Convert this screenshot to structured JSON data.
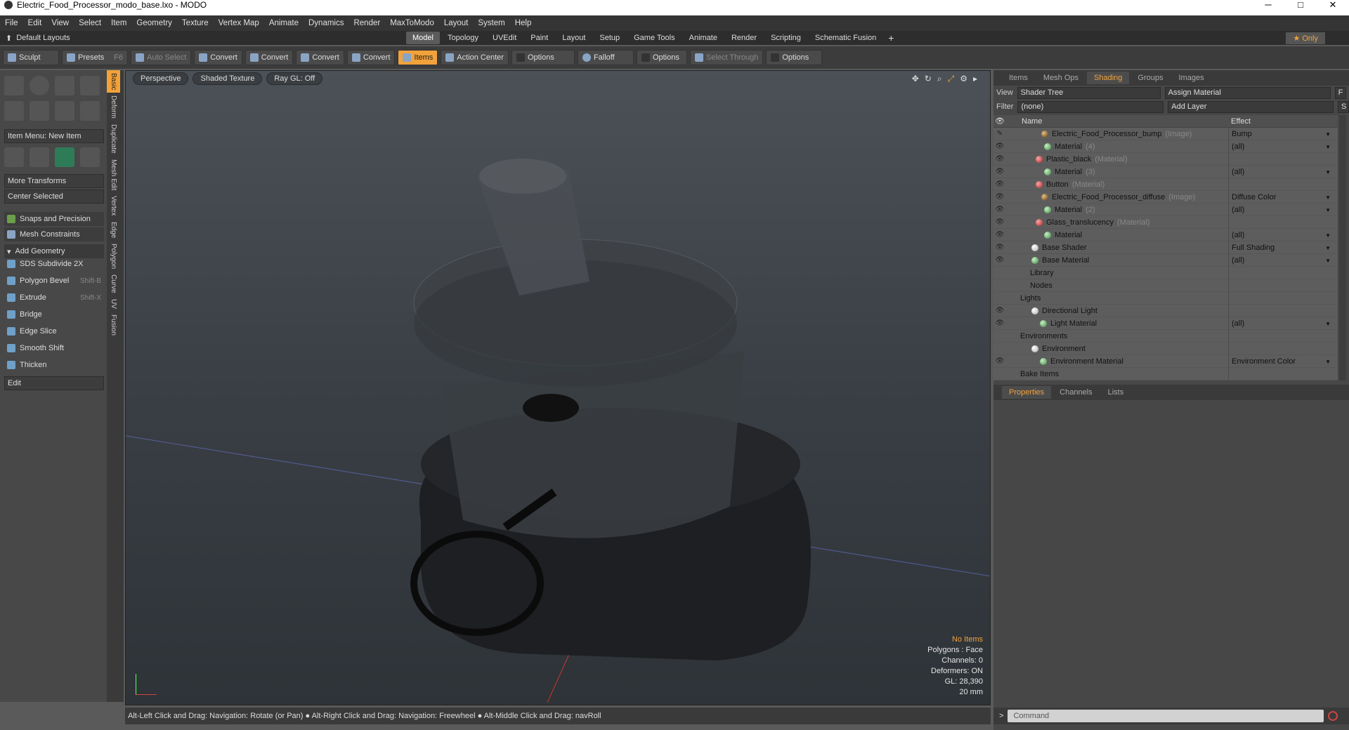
{
  "window": {
    "title": "Electric_Food_Processor_modo_base.lxo - MODO",
    "min": "─",
    "max": "□",
    "close": "✕"
  },
  "menu": [
    "File",
    "Edit",
    "View",
    "Select",
    "Item",
    "Geometry",
    "Texture",
    "Vertex Map",
    "Animate",
    "Dynamics",
    "Render",
    "MaxToModo",
    "Layout",
    "System",
    "Help"
  ],
  "layoutbar": {
    "default_layouts": "Default Layouts",
    "tabs": [
      "Model",
      "Topology",
      "UVEdit",
      "Paint",
      "Layout",
      "Setup",
      "Game Tools",
      "Animate",
      "Render",
      "Scripting",
      "Schematic Fusion"
    ],
    "active_tab": "Model",
    "plus": "+",
    "only": "★ Only"
  },
  "toolbar": {
    "sculpt": "Sculpt",
    "presets": "Presets",
    "presets_key": "F6",
    "auto_select": "Auto Select",
    "convert1": "Convert",
    "convert2": "Convert",
    "convert3": "Convert",
    "convert4": "Convert",
    "items": "Items",
    "action_center": "Action Center",
    "options1": "Options",
    "falloff": "Falloff",
    "options2": "Options",
    "select_through": "Select Through",
    "options3": "Options"
  },
  "left": {
    "item_menu": "Item Menu: New Item",
    "more_transforms": "More Transforms",
    "center_selected": "Center Selected",
    "snaps": "Snaps and Precision",
    "mesh_constraints": "Mesh Constraints",
    "add_geometry": "Add Geometry",
    "tools": [
      {
        "label": "SDS Subdivide 2X",
        "key": ""
      },
      {
        "label": "Polygon Bevel",
        "key": "Shift-B"
      },
      {
        "label": "Extrude",
        "key": "Shift-X"
      },
      {
        "label": "Bridge",
        "key": ""
      },
      {
        "label": "Edge Slice",
        "key": ""
      },
      {
        "label": "Smooth Shift",
        "key": ""
      },
      {
        "label": "Thicken",
        "key": ""
      }
    ],
    "edit": "Edit",
    "vtabs": [
      "Basic",
      "Deform",
      "Duplicate",
      "Mesh Edit",
      "Vertex",
      "Edge",
      "Polygon",
      "Curve",
      "UV",
      "Fusion"
    ]
  },
  "viewport": {
    "perspective": "Perspective",
    "shaded": "Shaded Texture",
    "raygl": "Ray GL: Off",
    "info": {
      "no_items": "No Items",
      "polygons": "Polygons : Face",
      "channels": "Channels: 0",
      "deformers": "Deformers: ON",
      "gl": "GL: 28,390",
      "scale": "20 mm"
    }
  },
  "status": "Alt-Left Click and Drag: Navigation: Rotate (or Pan) ● Alt-Right Click and Drag: Navigation: Freewheel ● Alt-Middle Click and Drag: navRoll",
  "right": {
    "tabs": [
      "Items",
      "Mesh Ops",
      "Shading",
      "Groups",
      "Images"
    ],
    "active_tab": "Shading",
    "view_label": "View",
    "view_value": "Shader Tree",
    "assign_material": "Assign Material",
    "f_btn": "F",
    "filter_label": "Filter",
    "filter_value": "(none)",
    "add_layer": "Add Layer",
    "s_btn": "S",
    "col_name": "Name",
    "col_effect": "Effect",
    "tree": [
      {
        "indent": 66,
        "icon": "i",
        "name": "Electric_Food_Processor_bump",
        "sub": "(Image)",
        "effect": "Bump",
        "eye": "✎"
      },
      {
        "indent": 70,
        "icon": "m",
        "name": "Material",
        "sub": "(4)",
        "effect": "(all)",
        "eye": "👁"
      },
      {
        "indent": 58,
        "icon": "r",
        "name": "Plastic_black",
        "sub": "(Material)",
        "effect": "",
        "eye": "👁"
      },
      {
        "indent": 70,
        "icon": "m",
        "name": "Material",
        "sub": "(3)",
        "effect": "(all)",
        "eye": "👁"
      },
      {
        "indent": 58,
        "icon": "r",
        "name": "Button",
        "sub": "(Material)",
        "effect": "",
        "eye": "👁"
      },
      {
        "indent": 66,
        "icon": "i",
        "name": "Electric_Food_Processor_diffuse",
        "sub": "(Image)",
        "effect": "Diffuse Color",
        "eye": "👁"
      },
      {
        "indent": 70,
        "icon": "m",
        "name": "Material",
        "sub": "(2)",
        "effect": "(all)",
        "eye": "👁"
      },
      {
        "indent": 58,
        "icon": "r",
        "name": "Glass_translucency",
        "sub": "(Material)",
        "effect": "",
        "eye": "👁"
      },
      {
        "indent": 70,
        "icon": "m",
        "name": "Material",
        "sub": "",
        "effect": "(all)",
        "eye": "👁"
      },
      {
        "indent": 52,
        "icon": "w",
        "name": "Base Shader",
        "sub": "",
        "effect": "Full Shading",
        "eye": "👁"
      },
      {
        "indent": 52,
        "icon": "m",
        "name": "Base Material",
        "sub": "",
        "effect": "(all)",
        "eye": "👁"
      },
      {
        "indent": 50,
        "icon": "",
        "name": "Library",
        "sub": "",
        "effect": "",
        "eye": ""
      },
      {
        "indent": 50,
        "icon": "",
        "name": "Nodes",
        "sub": "",
        "effect": "",
        "eye": ""
      },
      {
        "indent": 36,
        "icon": "",
        "name": "Lights",
        "sub": "",
        "effect": "",
        "eye": ""
      },
      {
        "indent": 52,
        "icon": "w",
        "name": "Directional Light",
        "sub": "",
        "effect": "",
        "eye": "👁"
      },
      {
        "indent": 64,
        "icon": "m",
        "name": "Light Material",
        "sub": "",
        "effect": "(all)",
        "eye": "👁"
      },
      {
        "indent": 36,
        "icon": "",
        "name": "Environments",
        "sub": "",
        "effect": "",
        "eye": ""
      },
      {
        "indent": 52,
        "icon": "w",
        "name": "Environment",
        "sub": "",
        "effect": "",
        "eye": ""
      },
      {
        "indent": 64,
        "icon": "m",
        "name": "Environment Material",
        "sub": "",
        "effect": "Environment Color",
        "eye": "👁"
      },
      {
        "indent": 36,
        "icon": "",
        "name": "Bake Items",
        "sub": "",
        "effect": "",
        "eye": ""
      }
    ],
    "bottom_tabs": [
      "Properties",
      "Channels",
      "Lists"
    ],
    "bottom_active": "Properties",
    "command_placeholder": "Command"
  }
}
